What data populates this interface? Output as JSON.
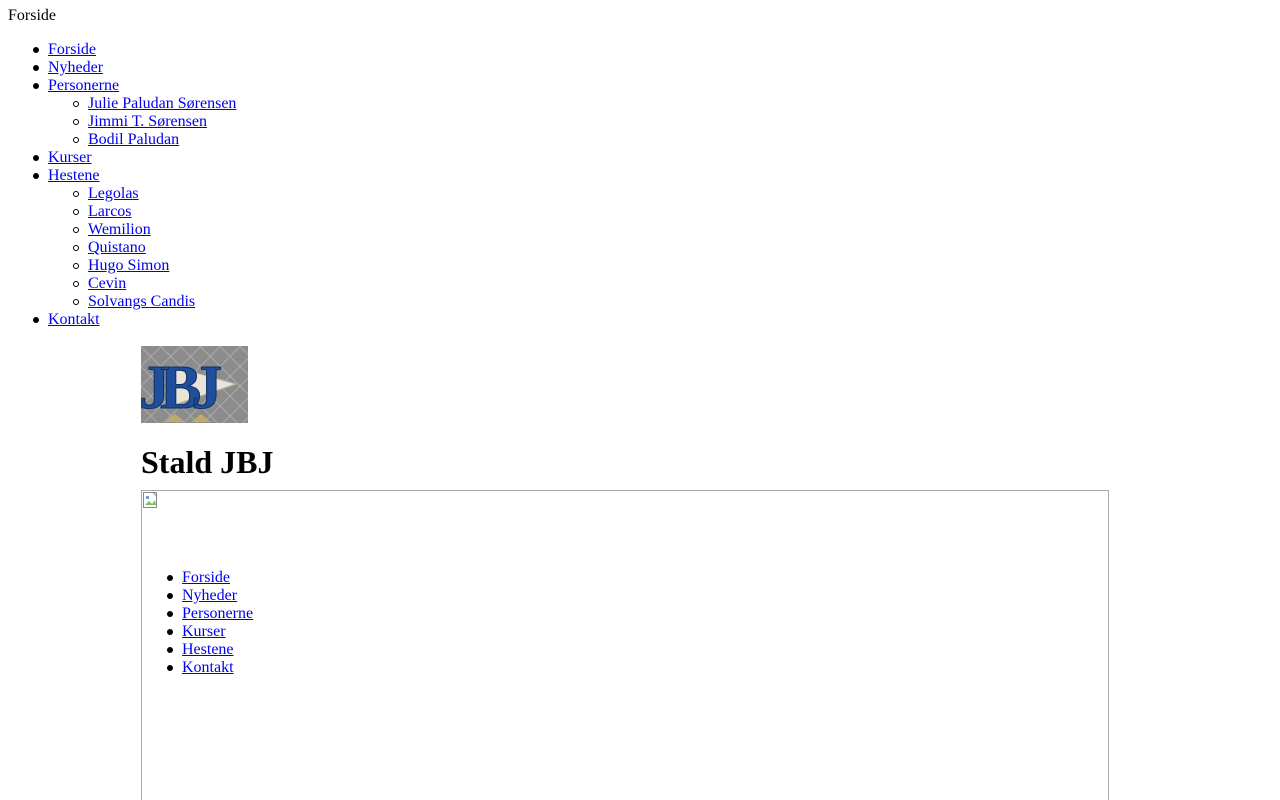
{
  "page": {
    "title": "Forside"
  },
  "nav": {
    "items": [
      {
        "label": "Forside"
      },
      {
        "label": "Nyheder"
      },
      {
        "label": "Personerne",
        "children": [
          "Julie Paludan Sørensen",
          "Jimmi T. Sørensen",
          "Bodil Paludan"
        ]
      },
      {
        "label": "Kurser"
      },
      {
        "label": "Hestene",
        "children": [
          "Legolas",
          "Larcos",
          "Wemilion",
          "Quistano",
          "Hugo Simon",
          "Cevin",
          "Solvangs Candis"
        ]
      },
      {
        "label": "Kontakt"
      }
    ]
  },
  "logo": {
    "text": "JBJ",
    "colors": {
      "letters": "#1f4e9a",
      "background": "#8c8c8c",
      "diamond": "#e8e4da"
    }
  },
  "heading": "Stald JBJ",
  "inner_nav": {
    "items": [
      "Forside",
      "Nyheder",
      "Personerne",
      "Kurser",
      "Hestene",
      "Kontakt"
    ]
  },
  "icons": {
    "broken_image": "broken-image-icon"
  }
}
